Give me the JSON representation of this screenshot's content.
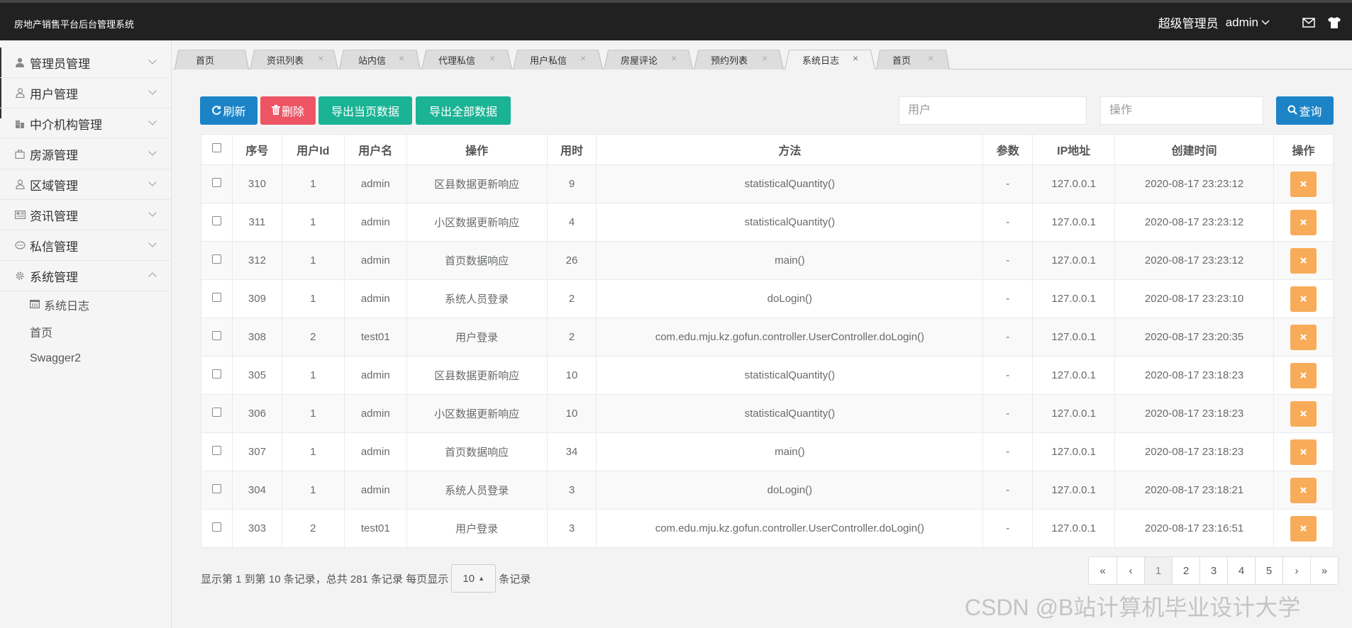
{
  "topbar": {
    "title": "房地产销售平台后台管理系统",
    "role": "超级管理员",
    "username": "admin",
    "icons": [
      "mail-icon",
      "tshirt-icon"
    ]
  },
  "sidebar": {
    "items": [
      {
        "label": "管理员管理",
        "icon": "user-icon"
      },
      {
        "label": "用户管理",
        "icon": "user-outline-icon"
      },
      {
        "label": "中介机构管理",
        "icon": "building-icon"
      },
      {
        "label": "房源管理",
        "icon": "briefcase-icon"
      },
      {
        "label": "区域管理",
        "icon": "user-outline-icon"
      },
      {
        "label": "资讯管理",
        "icon": "newspaper-icon"
      },
      {
        "label": "私信管理",
        "icon": "chat-icon"
      },
      {
        "label": "系统管理",
        "icon": "gear-icon"
      }
    ],
    "subitems": [
      {
        "label": "系统日志",
        "icon": "calendar-icon"
      },
      {
        "label": "首页"
      },
      {
        "label": "Swagger2"
      }
    ]
  },
  "tabs": [
    {
      "label": "首页"
    },
    {
      "label": "资讯列表"
    },
    {
      "label": "站内信"
    },
    {
      "label": "代理私信"
    },
    {
      "label": "用户私信"
    },
    {
      "label": "房屋评论"
    },
    {
      "label": "预约列表"
    },
    {
      "label": "系统日志",
      "active": true
    },
    {
      "label": "首页"
    }
  ],
  "toolbar": {
    "refresh": "刷新",
    "delete": "删除",
    "export_page": "导出当页数据",
    "export_all": "导出全部数据",
    "user_placeholder": "用户",
    "op_placeholder": "操作",
    "query": "查询"
  },
  "table": {
    "headers": [
      "序号",
      "用户Id",
      "用户名",
      "操作",
      "用时",
      "方法",
      "参数",
      "IP地址",
      "创建时间",
      "操作"
    ],
    "rows": [
      [
        "310",
        "1",
        "admin",
        "区县数据更新响应",
        "9",
        "statisticalQuantity()",
        "-",
        "127.0.0.1",
        "2020-08-17 23:23:12"
      ],
      [
        "311",
        "1",
        "admin",
        "小区数据更新响应",
        "4",
        "statisticalQuantity()",
        "-",
        "127.0.0.1",
        "2020-08-17 23:23:12"
      ],
      [
        "312",
        "1",
        "admin",
        "首页数据响应",
        "26",
        "main()",
        "-",
        "127.0.0.1",
        "2020-08-17 23:23:12"
      ],
      [
        "309",
        "1",
        "admin",
        "系统人员登录",
        "2",
        "doLogin()",
        "-",
        "127.0.0.1",
        "2020-08-17 23:23:10"
      ],
      [
        "308",
        "2",
        "test01",
        "用户登录",
        "2",
        "com.edu.mju.kz.gofun.controller.UserController.doLogin()",
        "-",
        "127.0.0.1",
        "2020-08-17 23:20:35"
      ],
      [
        "305",
        "1",
        "admin",
        "区县数据更新响应",
        "10",
        "statisticalQuantity()",
        "-",
        "127.0.0.1",
        "2020-08-17 23:18:23"
      ],
      [
        "306",
        "1",
        "admin",
        "小区数据更新响应",
        "10",
        "statisticalQuantity()",
        "-",
        "127.0.0.1",
        "2020-08-17 23:18:23"
      ],
      [
        "307",
        "1",
        "admin",
        "首页数据响应",
        "34",
        "main()",
        "-",
        "127.0.0.1",
        "2020-08-17 23:18:23"
      ],
      [
        "304",
        "1",
        "admin",
        "系统人员登录",
        "3",
        "doLogin()",
        "-",
        "127.0.0.1",
        "2020-08-17 23:18:21"
      ],
      [
        "303",
        "2",
        "test01",
        "用户登录",
        "3",
        "com.edu.mju.kz.gofun.controller.UserController.doLogin()",
        "-",
        "127.0.0.1",
        "2020-08-17 23:16:51"
      ]
    ]
  },
  "pager": {
    "info_prefix": "显示第 1 到第 10 条记录，总共 281 条记录 每页显示",
    "page_size": "10",
    "info_suffix": "条记录",
    "first": "«",
    "prev": "‹",
    "pages": [
      "1",
      "2",
      "3",
      "4",
      "5"
    ],
    "current": "1",
    "next": "›",
    "last": "»"
  },
  "watermark": "CSDN @B站计算机毕业设计大学"
}
